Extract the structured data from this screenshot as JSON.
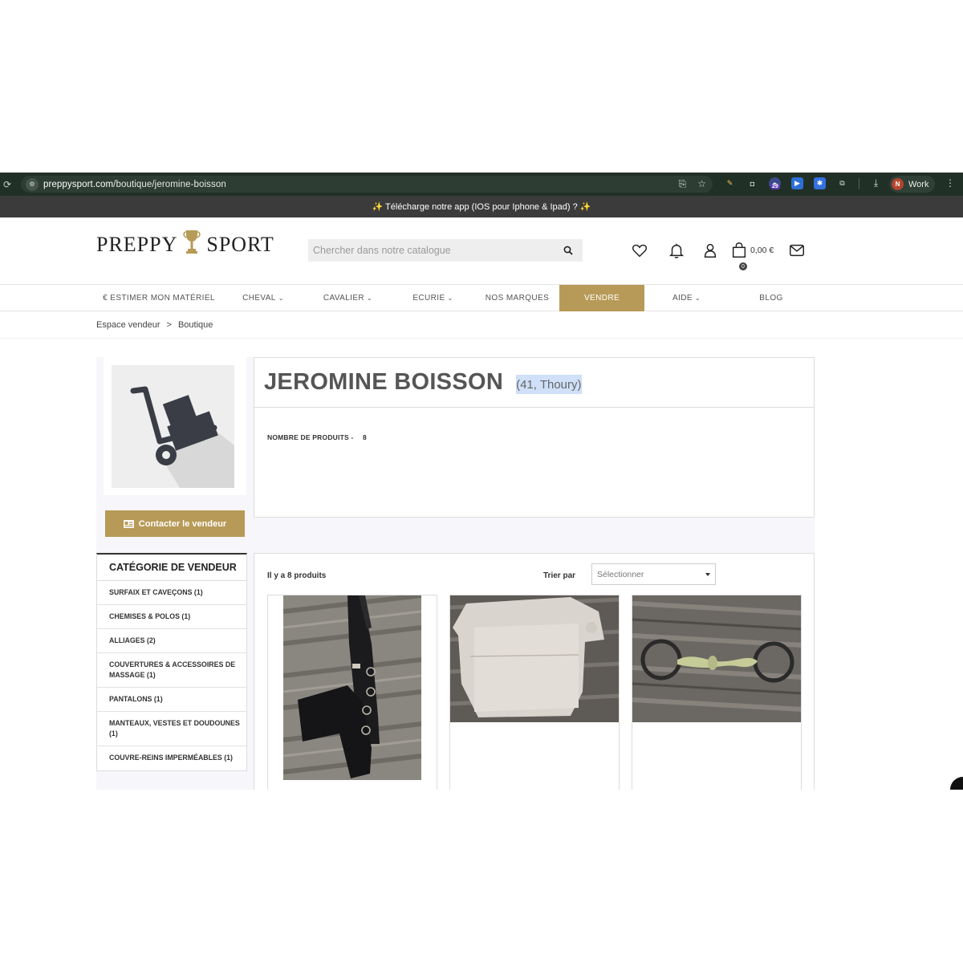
{
  "browser": {
    "url_host": "preppysport.com",
    "url_path": "/boutique/jeromine-boisson",
    "ext_badge": "29",
    "profile_initial": "N",
    "profile_label": "Work"
  },
  "promo": {
    "text": "✨ Télécharge notre app (IOS pour Iphone & Ipad) ? ✨"
  },
  "header": {
    "logo_left": "PREPPY",
    "logo_right": "SPORT",
    "search_placeholder": "Chercher dans notre catalogue",
    "cart_amount": "0,00 €",
    "cart_count": "0"
  },
  "nav": {
    "items": [
      {
        "label": "€  ESTIMER MON MATÉRIEL",
        "chevron": false,
        "active": false
      },
      {
        "label": "CHEVAL",
        "chevron": true,
        "active": false
      },
      {
        "label": "CAVALIER",
        "chevron": true,
        "active": false
      },
      {
        "label": "ECURIE",
        "chevron": true,
        "active": false
      },
      {
        "label": "NOS MARQUES",
        "chevron": false,
        "active": false
      },
      {
        "label": "VENDRE",
        "chevron": false,
        "active": true
      },
      {
        "label": "AIDE",
        "chevron": true,
        "active": false
      },
      {
        "label": "BLOG",
        "chevron": false,
        "active": false
      }
    ]
  },
  "breadcrumb": {
    "level1": "Espace vendeur",
    "separator": ">",
    "level2": "Boutique"
  },
  "seller": {
    "name": "JEROMINE BOISSON",
    "location": "(41, Thoury)",
    "count_label": "NOMBRE DE PRODUITS -",
    "count_value": "8",
    "contact_label": "Contacter le vendeur"
  },
  "categories": {
    "title": "CATÉGORIE DE VENDEUR",
    "items": [
      "SURFAIX ET CAVEÇONS (1)",
      "CHEMISES & POLOS (1)",
      "ALLIAGES (2)",
      "COUVERTURES & ACCESSOIRES DE MASSAGE (1)",
      "PANTALONS (1)",
      "MANTEAUX, VESTES ET DOUDOUNES (1)",
      "COUVRE-REINS IMPERMÉABLES (1)"
    ]
  },
  "products": {
    "count_label": "Il y a 8 produits",
    "sort_label": "Trier par",
    "sort_value": "Sélectionner",
    "items": [
      {
        "image": "black-fleece-boots-photo"
      },
      {
        "image": "white-shirt-photo"
      },
      {
        "image": "loose-ring-bit-photo"
      }
    ]
  },
  "colors": {
    "accent": "#b79a57",
    "browser_bg": "#213027",
    "promo_bg": "#3b3b3b"
  }
}
